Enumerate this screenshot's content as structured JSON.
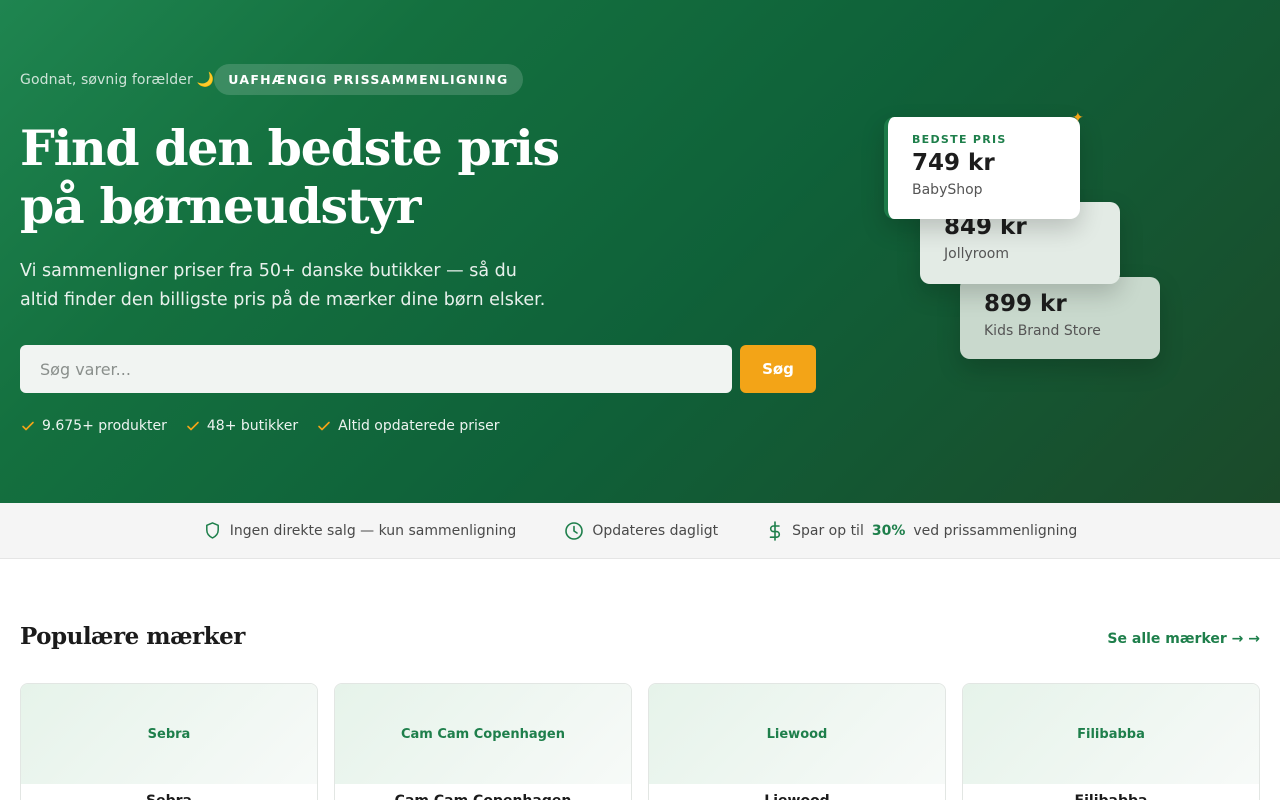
{
  "hero": {
    "greeting": "Godnat, søvnig forælder",
    "greeting_emoji": "🌙",
    "badge": "UAFHÆNGIG PRISSAMMENLIGNING",
    "title": "Find den bedste pris på børneudstyr",
    "subtitle": "Vi sammenligner priser fra 50+ danske butikker — så du altid finder den billigste pris på de mærker dine børn elsker.",
    "search": {
      "placeholder": "Søg varer...",
      "button_label": "Søg"
    },
    "checks": [
      "9.675+ produkter",
      "48+ butikker",
      "Altid opdaterede priser"
    ],
    "price_cards": [
      {
        "label": "BEDSTE PRIS",
        "price": "749 kr",
        "store": "BabyShop"
      },
      {
        "price": "849 kr",
        "store": "Jollyroom"
      },
      {
        "price": "899 kr",
        "store": "Kids Brand Store"
      }
    ]
  },
  "trust": {
    "no_sales": "Ingen direkte salg — kun sammenligning",
    "updated": "Opdateres dagligt",
    "save_prefix": "Spar op til",
    "save_pct": "30%",
    "save_suffix": "ved prissammenligning"
  },
  "brands": {
    "title": "Populære mærker",
    "see_all": "Se alle mærker → →",
    "items": [
      {
        "logo_text": "Sebra",
        "name": "Sebra"
      },
      {
        "logo_text": "Cam Cam Copenhagen",
        "name": "Cam Cam Copenhagen"
      },
      {
        "logo_text": "Liewood",
        "name": "Liewood"
      },
      {
        "logo_text": "Filibabba",
        "name": "Filibabba"
      }
    ]
  },
  "colors": {
    "brand_green": "#1e7f4b",
    "accent_orange": "#f3a417",
    "hero_dark": "#0f6139"
  }
}
